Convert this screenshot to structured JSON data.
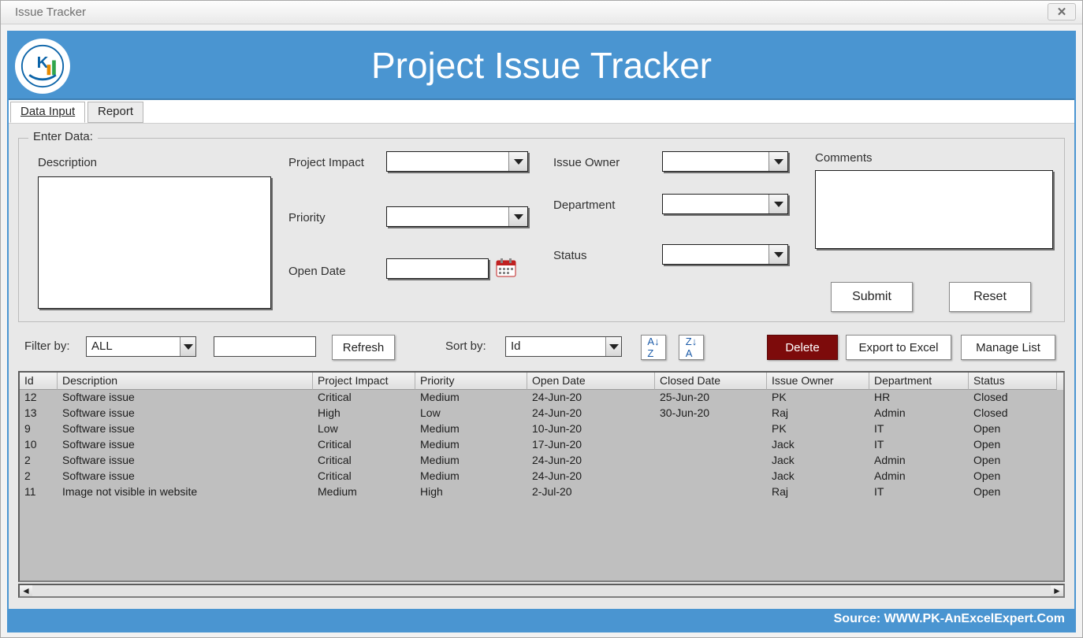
{
  "window": {
    "title": "Issue Tracker"
  },
  "banner": {
    "title": "Project Issue Tracker"
  },
  "tabs": [
    {
      "label": "Data Input"
    },
    {
      "label": "Report"
    }
  ],
  "group_legend": "Enter Data:",
  "labels": {
    "description": "Description",
    "project_impact": "Project Impact",
    "priority": "Priority",
    "open_date": "Open Date",
    "issue_owner": "Issue Owner",
    "department": "Department",
    "status": "Status",
    "comments": "Comments"
  },
  "buttons": {
    "submit": "Submit",
    "reset": "Reset",
    "refresh": "Refresh",
    "delete": "Delete",
    "export": "Export to Excel",
    "manage": "Manage List"
  },
  "toolbar": {
    "filter_by": "Filter by:",
    "filter_value": "ALL",
    "sort_by": "Sort by:",
    "sort_value": "Id"
  },
  "table": {
    "headers": [
      "Id",
      "Description",
      "Project Impact",
      "Priority",
      "Open Date",
      "Closed Date",
      "Issue Owner",
      "Department",
      "Status"
    ],
    "rows": [
      [
        "12",
        "Software issue",
        "Critical",
        "Medium",
        "24-Jun-20",
        "25-Jun-20",
        "PK",
        "HR",
        "Closed"
      ],
      [
        "13",
        "Software issue",
        "High",
        "Low",
        "24-Jun-20",
        "30-Jun-20",
        "Raj",
        "Admin",
        "Closed"
      ],
      [
        "9",
        "Software issue",
        "Low",
        "Medium",
        "10-Jun-20",
        "",
        "PK",
        "IT",
        "Open"
      ],
      [
        "10",
        "Software issue",
        "Critical",
        "Medium",
        "17-Jun-20",
        "",
        "Jack",
        "IT",
        "Open"
      ],
      [
        "2",
        "Software issue",
        "Critical",
        "Medium",
        "24-Jun-20",
        "",
        "Jack",
        "Admin",
        "Open"
      ],
      [
        "2",
        "Software issue",
        "Critical",
        "Medium",
        "24-Jun-20",
        "",
        "Jack",
        "Admin",
        "Open"
      ],
      [
        "11",
        "Image not visible in website",
        "Medium",
        "High",
        "2-Jul-20",
        "",
        "Raj",
        "IT",
        "Open"
      ]
    ]
  },
  "footer": {
    "text": "Source: WWW.PK-AnExcelExpert.Com"
  }
}
